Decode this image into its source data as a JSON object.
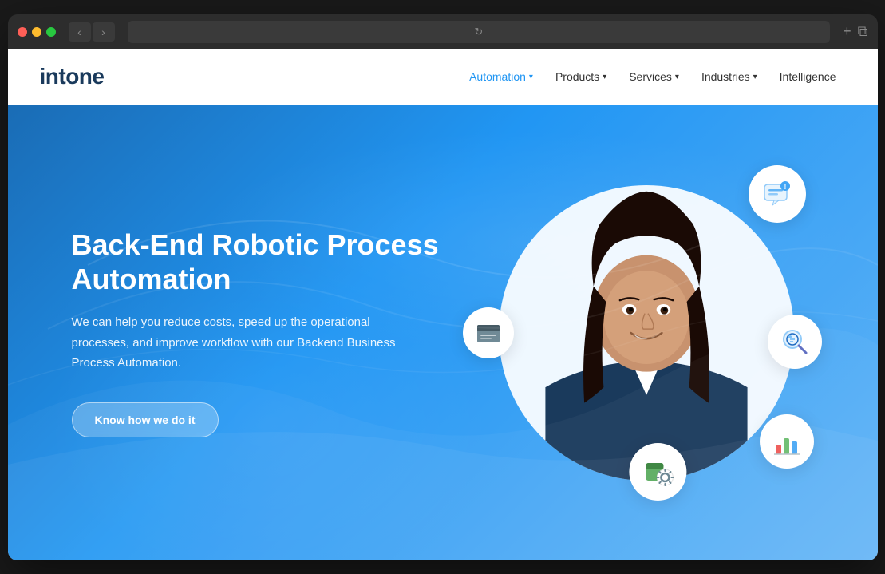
{
  "browser": {
    "traffic_lights": [
      "red",
      "yellow",
      "green"
    ],
    "back_label": "‹",
    "forward_label": "›",
    "address": "",
    "reload_icon": "↻",
    "new_tab_icon": "+",
    "window_icon": "⧉"
  },
  "header": {
    "logo": "intone",
    "nav": [
      {
        "id": "automation",
        "label": "Automation",
        "has_dropdown": true,
        "active": true
      },
      {
        "id": "products",
        "label": "Products",
        "has_dropdown": true,
        "active": false
      },
      {
        "id": "services",
        "label": "Services",
        "has_dropdown": true,
        "active": false
      },
      {
        "id": "industries",
        "label": "Industries",
        "has_dropdown": true,
        "active": false
      },
      {
        "id": "intelligence",
        "label": "Intelligence",
        "has_dropdown": false,
        "active": false
      }
    ]
  },
  "hero": {
    "title": "Back-End Robotic Process Automation",
    "description": "We can help you reduce costs, speed up the operational processes, and improve workflow with our Backend Business Process Automation.",
    "cta_label": "Know how we do it",
    "icons": [
      {
        "name": "chat-icon",
        "symbol": "💬",
        "position": "top-right"
      },
      {
        "name": "inbox-icon",
        "symbol": "📥",
        "position": "left-mid"
      },
      {
        "name": "search-icon",
        "symbol": "🔍",
        "position": "right-mid"
      },
      {
        "name": "chart-icon",
        "symbol": "📊",
        "position": "right-bottom"
      },
      {
        "name": "gear-icon",
        "symbol": "⚙️",
        "position": "bottom-center"
      }
    ]
  }
}
